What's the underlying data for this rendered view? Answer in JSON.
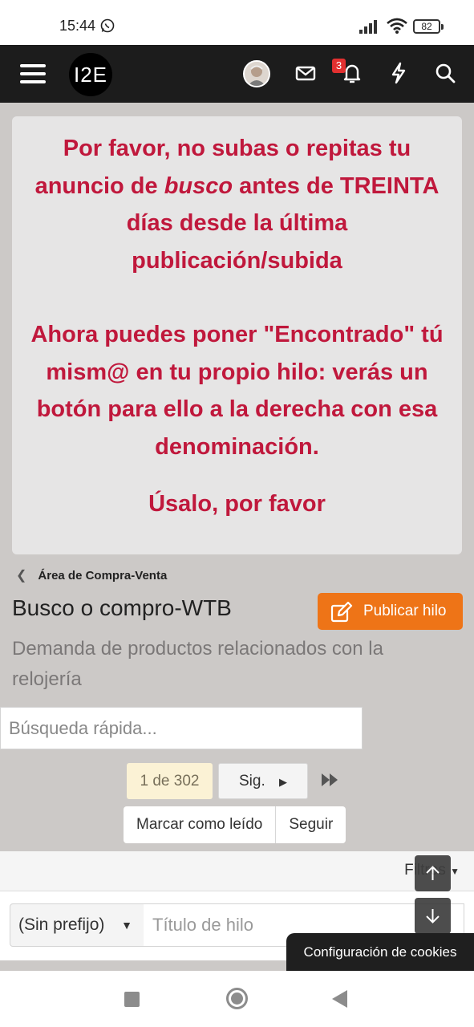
{
  "status_bar": {
    "time": "15:44",
    "battery": "82",
    "icons": [
      "whatsapp-icon",
      "signal-icon",
      "wifi-icon",
      "battery-icon"
    ]
  },
  "header": {
    "logo_text": "I2E",
    "notification_count": "3",
    "icons": [
      "menu-icon",
      "avatar",
      "mail-icon",
      "bell-icon",
      "lightning-icon",
      "search-icon"
    ]
  },
  "notice": {
    "line1_a": "Por favor, no subas o repitas tu anuncio de ",
    "line1_em": "busco",
    "line1_b": " antes de TREINTA días desde la última publicación/subida",
    "line2": "Ahora puedes poner \"Encontrado\" tú mism@ en tu propio hilo: verás un botón para ello a la derecha con esa denominación.",
    "line3": "Úsalo, por favor",
    "color": "#c0183c"
  },
  "breadcrumb": {
    "label": "Área de Compra-Venta"
  },
  "forum": {
    "title": "Busco o compro-WTB",
    "description": "Demanda de productos relacionados con la relojería",
    "publish_button": "Publicar hilo",
    "accent_color": "#ee7417"
  },
  "quick_search": {
    "placeholder": "Búsqueda rápida..."
  },
  "pagination": {
    "current": "1 de 302",
    "next": "Sig."
  },
  "actions": {
    "mark_read": "Marcar como leído",
    "follow": "Seguir"
  },
  "filters": {
    "label": "Filtros"
  },
  "new_thread": {
    "prefix": "(Sin prefijo)",
    "title_placeholder": "Título de hilo"
  },
  "cookies": {
    "label": "Configuración de cookies"
  }
}
